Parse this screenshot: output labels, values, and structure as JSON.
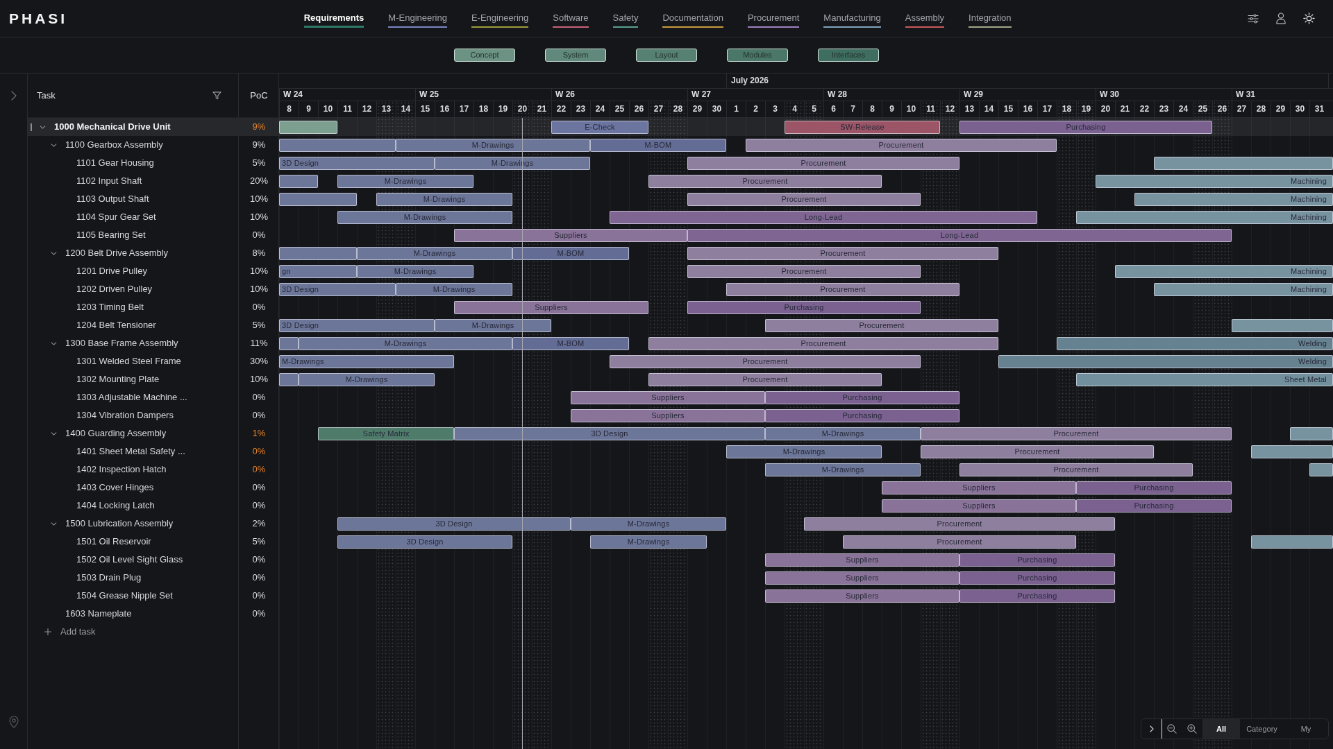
{
  "header": {
    "logo": "PHASI"
  },
  "tabs": [
    {
      "label": "Requirements",
      "selected": true,
      "color": "#2f7a68"
    },
    {
      "label": "M-Engineering",
      "selected": false,
      "color": "#7a86c4"
    },
    {
      "label": "E-Engineering",
      "selected": false,
      "color": "#9c9c3c"
    },
    {
      "label": "Software",
      "selected": false,
      "color": "#c8637b"
    },
    {
      "label": "Safety",
      "selected": false,
      "color": "#58a090"
    },
    {
      "label": "Documentation",
      "selected": false,
      "color": "#c89a3c"
    },
    {
      "label": "Procurement",
      "selected": false,
      "color": "#9e80c0"
    },
    {
      "label": "Manufacturing",
      "selected": false,
      "color": "#7fa2bb"
    },
    {
      "label": "Assembly",
      "selected": false,
      "color": "#cc5a5a"
    },
    {
      "label": "Integration",
      "selected": false,
      "color": "#a2a688"
    }
  ],
  "phases": [
    {
      "label": "Concept",
      "color": "#6b9283"
    },
    {
      "label": "System",
      "color": "#60897b"
    },
    {
      "label": "Layout",
      "color": "#568072"
    },
    {
      "label": "Modules",
      "color": "#4b7768"
    },
    {
      "label": "Interfaces",
      "color": "#3f6d5f"
    }
  ],
  "task_list": {
    "columns": [
      {
        "label": "Task",
        "filterable": true
      },
      {
        "label": "PoC",
        "filterable": false
      }
    ],
    "tasks": [
      {
        "name": "1000 Mechanical Drive Unit",
        "poc": "9%",
        "delayed": true,
        "selected": true,
        "expanded": true,
        "bars": [
          {
            "color": "#7d9f90"
          },
          {
            "label": "E-Check",
            "color": "#6b75a0"
          },
          {
            "label": "SW-Release",
            "color": "#9b5566"
          },
          {
            "label": "Purchasing",
            "color": "#7a6190"
          }
        ],
        "children": [
          {
            "name": "1100 Gearbox Assembly",
            "poc": "9%",
            "delayed": false,
            "selected": false,
            "expanded": true,
            "bars": [
              {
                "color": "#6c7698"
              },
              {
                "label": "M-Drawings",
                "color": "#6c7698"
              },
              {
                "label": "M-BOM",
                "color": "#636c94"
              },
              {
                "label": "Procurement",
                "color": "#8f7f9e"
              }
            ],
            "children": [
              {
                "name": "1101 Gear Housing",
                "poc": "5%",
                "delayed": false,
                "selected": false,
                "bars": [
                  {
                    "label": "3D Design",
                    "color": "#6c7698"
                  },
                  {
                    "label": "M-Drawings",
                    "color": "#6c7698"
                  },
                  {
                    "label": "Procurement",
                    "color": "#8f7f9e"
                  },
                  {
                    "color": "#7893a0"
                  }
                ]
              },
              {
                "name": "1102 Input Shaft",
                "poc": "20%",
                "delayed": false,
                "selected": false,
                "bars": [
                  {
                    "color": "#6c7698"
                  },
                  {
                    "label": "M-Drawings",
                    "color": "#6c7698"
                  },
                  {
                    "label": "Procurement",
                    "color": "#8f7f9e"
                  },
                  {
                    "label": "Machining",
                    "color": "#7893a0"
                  }
                ]
              },
              {
                "name": "1103 Output Shaft",
                "poc": "10%",
                "delayed": false,
                "selected": false,
                "bars": [
                  {
                    "color": "#6c7698"
                  },
                  {
                    "label": "M-Drawings",
                    "color": "#6c7698"
                  },
                  {
                    "label": "Procurement",
                    "color": "#8f7f9e"
                  },
                  {
                    "label": "Machining",
                    "color": "#7893a0"
                  }
                ]
              },
              {
                "name": "1104 Spur Gear Set",
                "poc": "10%",
                "delayed": false,
                "selected": false,
                "bars": [
                  {
                    "label": "M-Drawings",
                    "color": "#6c7698"
                  },
                  {
                    "label": "Long-Lead",
                    "color": "#7f6692"
                  },
                  {
                    "label": "Machining",
                    "color": "#7893a0"
                  }
                ]
              },
              {
                "name": "1105 Bearing Set",
                "poc": "0%",
                "delayed": false,
                "selected": false,
                "bars": [
                  {
                    "label": "Suppliers",
                    "color": "#8a7398"
                  },
                  {
                    "label": "Long-Lead",
                    "color": "#7f6692"
                  }
                ]
              }
            ]
          },
          {
            "name": "1200 Belt Drive Assembly",
            "poc": "8%",
            "delayed": false,
            "selected": false,
            "expanded": true,
            "bars": [
              {
                "color": "#6c7698"
              },
              {
                "label": "M-Drawings",
                "color": "#6c7698"
              },
              {
                "label": "M-BOM",
                "color": "#636c94"
              },
              {
                "label": "Procurement",
                "color": "#8f7f9e"
              }
            ],
            "children": [
              {
                "name": "1201 Drive Pulley",
                "poc": "10%",
                "delayed": false,
                "selected": false,
                "bars": [
                  {
                    "label": "gn",
                    "color": "#6c7698"
                  },
                  {
                    "label": "M-Drawings",
                    "color": "#6c7698"
                  },
                  {
                    "label": "Procurement",
                    "color": "#8f7f9e"
                  },
                  {
                    "label": "Machining",
                    "color": "#7893a0"
                  }
                ]
              },
              {
                "name": "1202 Driven Pulley",
                "poc": "10%",
                "delayed": false,
                "selected": false,
                "bars": [
                  {
                    "label": "3D Design",
                    "color": "#6c7698"
                  },
                  {
                    "label": "M-Drawings",
                    "color": "#6c7698"
                  },
                  {
                    "label": "Procurement",
                    "color": "#8f7f9e"
                  },
                  {
                    "label": "Machining",
                    "color": "#7893a0"
                  }
                ]
              },
              {
                "name": "1203 Timing Belt",
                "poc": "0%",
                "delayed": false,
                "selected": false,
                "bars": [
                  {
                    "label": "Suppliers",
                    "color": "#8a7398"
                  },
                  {
                    "label": "Purchasing",
                    "color": "#7a6190"
                  }
                ]
              },
              {
                "name": "1204 Belt Tensioner",
                "poc": "5%",
                "delayed": false,
                "selected": false,
                "bars": [
                  {
                    "label": "3D Design",
                    "color": "#6c7698"
                  },
                  {
                    "label": "M-Drawings",
                    "color": "#6c7698"
                  },
                  {
                    "label": "Procurement",
                    "color": "#8f7f9e"
                  },
                  {
                    "color": "#7893a0"
                  }
                ]
              }
            ]
          },
          {
            "name": "1300 Base Frame Assembly",
            "poc": "11%",
            "delayed": false,
            "selected": false,
            "expanded": true,
            "bars": [
              {
                "color": "#6c7698"
              },
              {
                "label": "M-Drawings",
                "color": "#6c7698"
              },
              {
                "label": "M-BOM",
                "color": "#636c94"
              },
              {
                "label": "Procurement",
                "color": "#8f7f9e"
              },
              {
                "label": "Welding",
                "color": "#66818f"
              }
            ],
            "children": [
              {
                "name": "1301 Welded Steel Frame",
                "poc": "30%",
                "delayed": false,
                "selected": false,
                "bars": [
                  {
                    "label": "M-Drawings",
                    "color": "#6c7698"
                  },
                  {
                    "label": "Procurement",
                    "color": "#8f7f9e"
                  },
                  {
                    "label": "Welding",
                    "color": "#66818f"
                  }
                ]
              },
              {
                "name": "1302 Mounting Plate",
                "poc": "10%",
                "delayed": false,
                "selected": false,
                "bars": [
                  {
                    "color": "#6c7698"
                  },
                  {
                    "label": "M-Drawings",
                    "color": "#6c7698"
                  },
                  {
                    "label": "Procurement",
                    "color": "#8f7f9e"
                  },
                  {
                    "label": "Sheet Metal",
                    "color": "#718f9d"
                  }
                ]
              },
              {
                "name": "1303 Adjustable Machine ...",
                "poc": "0%",
                "delayed": false,
                "selected": false,
                "bars": [
                  {
                    "label": "Suppliers",
                    "color": "#8a7398"
                  },
                  {
                    "label": "Purchasing",
                    "color": "#7a6190"
                  }
                ]
              },
              {
                "name": "1304 Vibration Dampers",
                "poc": "0%",
                "delayed": false,
                "selected": false,
                "bars": [
                  {
                    "label": "Suppliers",
                    "color": "#8a7398"
                  },
                  {
                    "label": "Purchasing",
                    "color": "#7a6190"
                  }
                ]
              }
            ]
          },
          {
            "name": "1400 Guarding Assembly",
            "poc": "1%",
            "delayed": true,
            "selected": false,
            "expanded": true,
            "bars": [
              {
                "label": "Safety Matrix",
                "color": "#4f7b6b"
              },
              {
                "label": "3D Design",
                "color": "#6c7698"
              },
              {
                "label": "M-Drawings",
                "color": "#6c7698"
              },
              {
                "label": "Procurement",
                "color": "#8f7f9e"
              },
              {
                "color": "#7893a0"
              }
            ],
            "children": [
              {
                "name": "1401 Sheet Metal Safety ...",
                "poc": "0%",
                "delayed": true,
                "selected": false,
                "bars": [
                  {
                    "label": "M-Drawings",
                    "color": "#6c7698"
                  },
                  {
                    "label": "Procurement",
                    "color": "#8f7f9e"
                  },
                  {
                    "color": "#7893a0"
                  }
                ]
              },
              {
                "name": "1402 Inspection Hatch",
                "poc": "0%",
                "delayed": true,
                "selected": false,
                "bars": [
                  {
                    "label": "M-Drawings",
                    "color": "#6c7698"
                  },
                  {
                    "label": "Procurement",
                    "color": "#8f7f9e"
                  },
                  {
                    "color": "#7893a0"
                  }
                ]
              },
              {
                "name": "1403 Cover Hinges",
                "poc": "0%",
                "delayed": false,
                "selected": false,
                "bars": [
                  {
                    "label": "Suppliers",
                    "color": "#8a7398"
                  },
                  {
                    "label": "Purchasing",
                    "color": "#7a6190"
                  }
                ]
              },
              {
                "name": "1404 Locking Latch",
                "poc": "0%",
                "delayed": false,
                "selected": false,
                "bars": [
                  {
                    "label": "Suppliers",
                    "color": "#8a7398"
                  },
                  {
                    "label": "Purchasing",
                    "color": "#7a6190"
                  }
                ]
              }
            ]
          },
          {
            "name": "1500 Lubrication Assembly",
            "poc": "2%",
            "delayed": false,
            "selected": false,
            "expanded": true,
            "bars": [
              {
                "label": "3D Design",
                "color": "#6c7698"
              },
              {
                "label": "M-Drawings",
                "color": "#6c7698"
              },
              {
                "label": "Procurement",
                "color": "#8f7f9e"
              }
            ],
            "children": [
              {
                "name": "1501 Oil Reservoir",
                "poc": "5%",
                "delayed": false,
                "selected": false,
                "bars": [
                  {
                    "label": "3D Design",
                    "color": "#6c7698"
                  },
                  {
                    "label": "M-Drawings",
                    "color": "#6c7698"
                  },
                  {
                    "label": "Procurement",
                    "color": "#8f7f9e"
                  },
                  {
                    "color": "#7893a0"
                  }
                ]
              },
              {
                "name": "1502 Oil Level Sight Glass",
                "poc": "0%",
                "delayed": false,
                "selected": false,
                "bars": [
                  {
                    "label": "Suppliers",
                    "color": "#8a7398"
                  },
                  {
                    "label": "Purchasing",
                    "color": "#7a6190"
                  }
                ]
              },
              {
                "name": "1503 Drain Plug",
                "poc": "0%",
                "delayed": false,
                "selected": false,
                "bars": [
                  {
                    "label": "Suppliers",
                    "color": "#8a7398"
                  },
                  {
                    "label": "Purchasing",
                    "color": "#7a6190"
                  }
                ]
              },
              {
                "name": "1504 Grease Nipple Set",
                "poc": "0%",
                "delayed": false,
                "selected": false,
                "bars": [
                  {
                    "label": "Suppliers",
                    "color": "#8a7398"
                  },
                  {
                    "label": "Purchasing",
                    "color": "#7a6190"
                  }
                ]
              }
            ]
          },
          {
            "name": "1603 Nameplate",
            "poc": "0%",
            "delayed": false,
            "selected": false
          }
        ]
      }
    ],
    "add_task": "Add task"
  },
  "timeline": {
    "weeks": [
      {
        "label": "W 24",
        "days": [
          {
            "label": "8",
            "weekend": false,
            "today": false
          },
          {
            "label": "9",
            "weekend": false,
            "today": false
          },
          {
            "label": "10",
            "weekend": false,
            "today": false
          },
          {
            "label": "11",
            "weekend": false,
            "today": false
          },
          {
            "label": "12",
            "weekend": false,
            "today": false
          },
          {
            "label": "13",
            "weekend": true,
            "today": false
          },
          {
            "label": "14",
            "weekend": true,
            "today": false
          }
        ]
      },
      {
        "label": "W 25",
        "days": [
          {
            "label": "15",
            "weekend": false,
            "today": false
          },
          {
            "label": "16",
            "weekend": false,
            "today": false
          },
          {
            "label": "17",
            "weekend": false,
            "today": false
          },
          {
            "label": "18",
            "weekend": false,
            "today": false
          },
          {
            "label": "19",
            "weekend": false,
            "today": false
          },
          {
            "label": "20",
            "weekend": true,
            "today": true
          },
          {
            "label": "21",
            "weekend": true,
            "today": false
          }
        ]
      },
      {
        "label": "W 26",
        "days": [
          {
            "label": "22",
            "weekend": false,
            "today": false
          },
          {
            "label": "23",
            "weekend": false,
            "today": false
          },
          {
            "label": "24",
            "weekend": false,
            "today": false
          },
          {
            "label": "25",
            "weekend": false,
            "today": false
          },
          {
            "label": "26",
            "weekend": false,
            "today": false
          },
          {
            "label": "27",
            "weekend": true,
            "today": false
          },
          {
            "label": "28",
            "weekend": true,
            "today": false
          }
        ]
      },
      {
        "label": "W 27",
        "days": [
          {
            "label": "29",
            "weekend": false,
            "today": false
          },
          {
            "label": "30",
            "weekend": false,
            "today": false
          },
          {
            "label": "1",
            "weekend": false,
            "today": false,
            "month_label": "July 2026"
          },
          {
            "label": "2",
            "weekend": false,
            "today": false
          },
          {
            "label": "3",
            "weekend": false,
            "today": false
          },
          {
            "label": "4",
            "weekend": true,
            "today": false
          },
          {
            "label": "5",
            "weekend": true,
            "today": false
          }
        ]
      },
      {
        "label": "W 28",
        "days": [
          {
            "label": "6",
            "weekend": false,
            "today": false
          },
          {
            "label": "7",
            "weekend": false,
            "today": false
          },
          {
            "label": "8",
            "weekend": false,
            "today": false
          },
          {
            "label": "9",
            "weekend": false,
            "today": false
          },
          {
            "label": "10",
            "weekend": false,
            "today": false
          },
          {
            "label": "11",
            "weekend": true,
            "today": false
          },
          {
            "label": "12",
            "weekend": true,
            "today": false
          }
        ]
      },
      {
        "label": "W 29",
        "days": [
          {
            "label": "13",
            "weekend": false,
            "today": false
          },
          {
            "label": "14",
            "weekend": false,
            "today": false
          },
          {
            "label": "15",
            "weekend": false,
            "today": false
          },
          {
            "label": "16",
            "weekend": false,
            "today": false
          },
          {
            "label": "17",
            "weekend": false,
            "today": false
          },
          {
            "label": "18",
            "weekend": true,
            "today": false
          },
          {
            "label": "19",
            "weekend": true,
            "today": false
          }
        ]
      },
      {
        "label": "W 30",
        "days": [
          {
            "label": "20",
            "weekend": false,
            "today": false
          },
          {
            "label": "21",
            "weekend": false,
            "today": false
          },
          {
            "label": "22",
            "weekend": false,
            "today": false
          },
          {
            "label": "23",
            "weekend": false,
            "today": false
          },
          {
            "label": "24",
            "weekend": false,
            "today": false
          },
          {
            "label": "25",
            "weekend": true,
            "today": false
          },
          {
            "label": "26",
            "weekend": true,
            "today": false
          }
        ]
      },
      {
        "label": "W 31",
        "days": [
          {
            "label": "27",
            "weekend": false,
            "today": false
          },
          {
            "label": "28",
            "weekend": false,
            "today": false
          },
          {
            "label": "29",
            "weekend": false,
            "today": false
          },
          {
            "label": "30",
            "weekend": false,
            "today": false
          },
          {
            "label": "31",
            "weekend": false,
            "today": false
          }
        ]
      }
    ]
  },
  "view_controls": {
    "options": [
      {
        "label": "All",
        "selected": true
      },
      {
        "label": "Category",
        "selected": false
      },
      {
        "label": "My",
        "selected": false
      }
    ]
  }
}
